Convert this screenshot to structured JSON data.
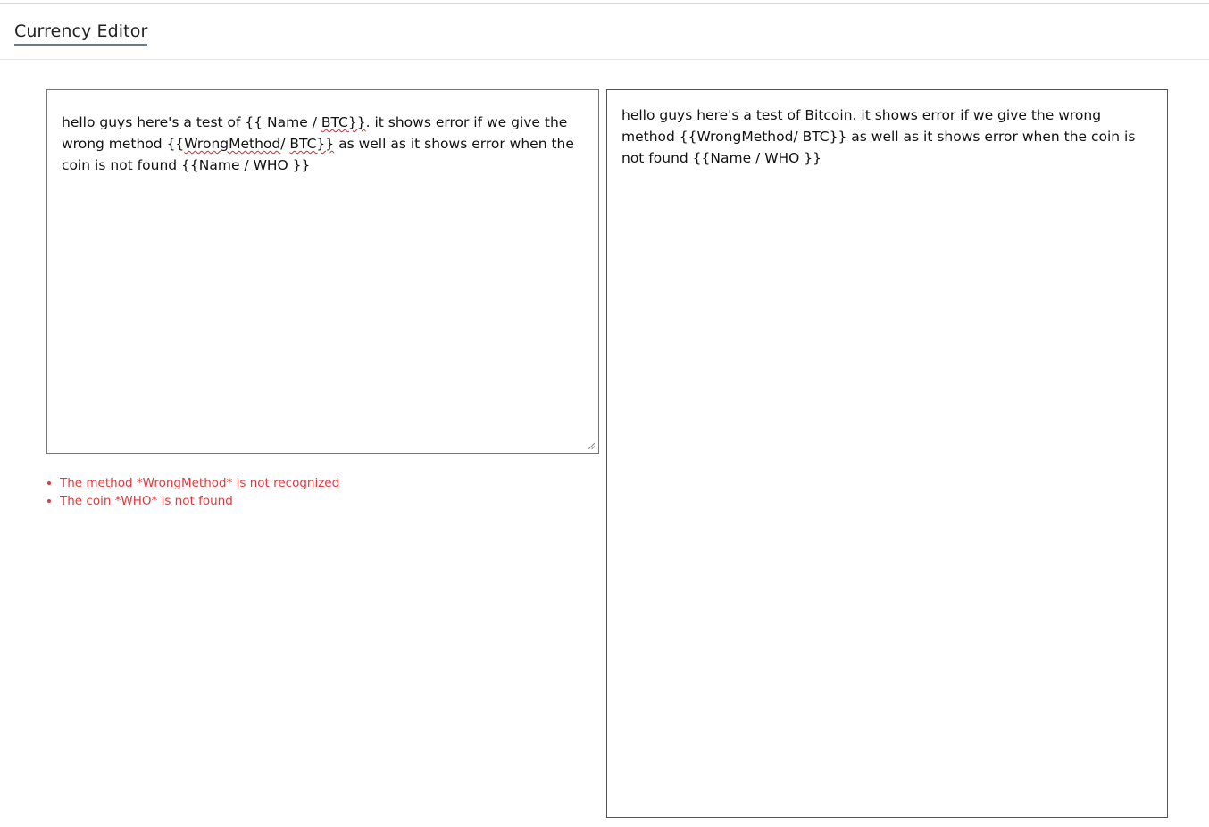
{
  "header": {
    "tab_title": "Currency Editor"
  },
  "editor": {
    "segments": [
      {
        "text": "hello guys here's a test of {{ Name / ",
        "flag": false
      },
      {
        "text": "BTC}}",
        "flag": true
      },
      {
        "text": ". it  shows error if we give the wrong method {{",
        "flag": false
      },
      {
        "text": "WrongMethod",
        "flag": true
      },
      {
        "text": "/ ",
        "flag": false
      },
      {
        "text": "BTC}}",
        "flag": true
      },
      {
        "text": "  as well as it shows error when the coin is not found {{Name / WHO }}",
        "flag": false
      }
    ]
  },
  "errors": [
    "The method *WrongMethod* is not recognized",
    "The coin *WHO* is not found"
  ],
  "preview": {
    "text": "hello guys here's a test of Bitcoin. it shows error if we give the wrong method {{WrongMethod/ BTC}} as well as it shows error when the coin is not found {{Name / WHO }}"
  },
  "colors": {
    "error": "#e0393e",
    "spellcheck": "#e02424",
    "tab_underline": "#6b7a8c"
  }
}
